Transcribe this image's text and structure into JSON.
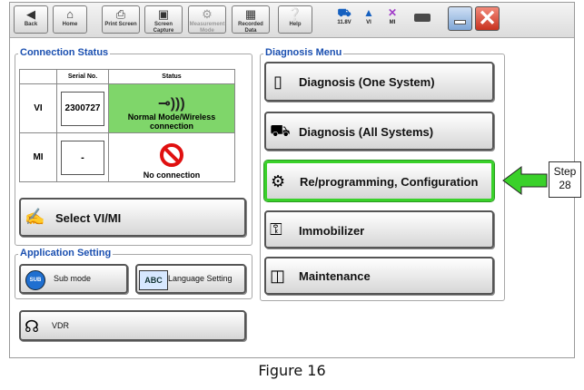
{
  "toolbar": {
    "buttons": [
      {
        "label": "Back",
        "icon": "left-arrow-icon"
      },
      {
        "label": "Home",
        "icon": "home-icon"
      },
      {
        "label": "Print Screen",
        "icon": "printer-icon"
      },
      {
        "label": "Screen Capture",
        "icon": "camera-icon"
      },
      {
        "label": "Measurement Mode",
        "icon": "meter-icon"
      },
      {
        "label": "Recorded Data",
        "icon": "record-icon"
      },
      {
        "label": "Help",
        "icon": "help-icon"
      }
    ],
    "status": [
      {
        "label": "11.8V",
        "icon": "car-icon"
      },
      {
        "label": "VI",
        "icon": "signal-icon"
      },
      {
        "label": "MI",
        "icon": "cross-icon"
      }
    ]
  },
  "connection_status": {
    "title": "Connection Status",
    "col_serial": "Serial No.",
    "col_status": "Status",
    "rows": [
      {
        "name": "VI",
        "serial": "2300727",
        "status": "Normal Mode/Wireless connection",
        "status_color": "#7fd66a"
      },
      {
        "name": "MI",
        "serial": "-",
        "status": "No connection",
        "status_color": "#ffffff"
      }
    ],
    "select_btn": "Select VI/MI"
  },
  "app_setting": {
    "title": "Application Setting",
    "sub_mode": "Sub mode",
    "sub_icon": "SUB",
    "language": "Language Setting",
    "lang_icon": "ABC"
  },
  "vdr": {
    "label": "VDR"
  },
  "diagnosis_menu": {
    "title": "Diagnosis Menu",
    "items": [
      {
        "label": "Diagnosis (One System)",
        "icon": "phone-icon"
      },
      {
        "label": "Diagnosis (All Systems)",
        "icon": "car-icon"
      },
      {
        "label": "Re/programming, Configuration",
        "icon": "reprogram-icon"
      },
      {
        "label": "Immobilizer",
        "icon": "key-icon"
      },
      {
        "label": "Maintenance",
        "icon": "monitor-icon"
      }
    ]
  },
  "annotation": {
    "step": "Step 28"
  },
  "caption": "Figure 16"
}
